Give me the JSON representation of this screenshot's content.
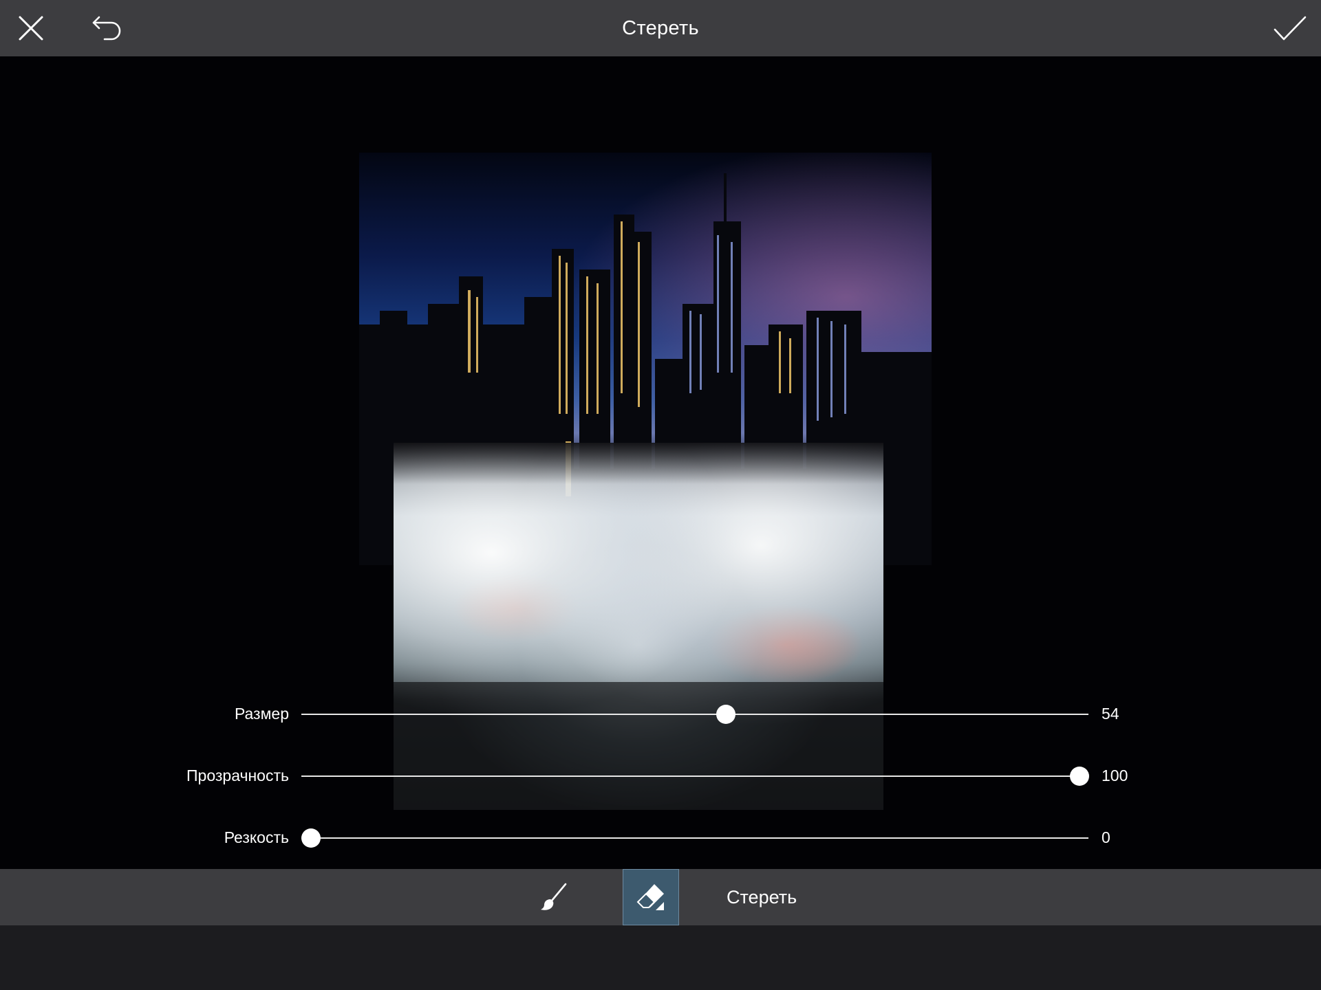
{
  "header": {
    "title": "Стереть",
    "close_icon": "close-icon",
    "undo_icon": "undo-icon",
    "apply_icon": "checkmark-icon"
  },
  "sliders": [
    {
      "label": "Размер",
      "value": "54",
      "level": 0.54
    },
    {
      "label": "Прозрачность",
      "value": "100",
      "level": 1.0
    },
    {
      "label": "Резкость",
      "value": "0",
      "level": 0.0
    }
  ],
  "toolbar": {
    "brush_icon": "brush-icon",
    "eraser_icon": "eraser-icon",
    "active_tool_label": "Стереть"
  },
  "colors": {
    "bar": "#3d3d40",
    "canvas": "#020205",
    "active_tool": "#3d5a6e"
  }
}
